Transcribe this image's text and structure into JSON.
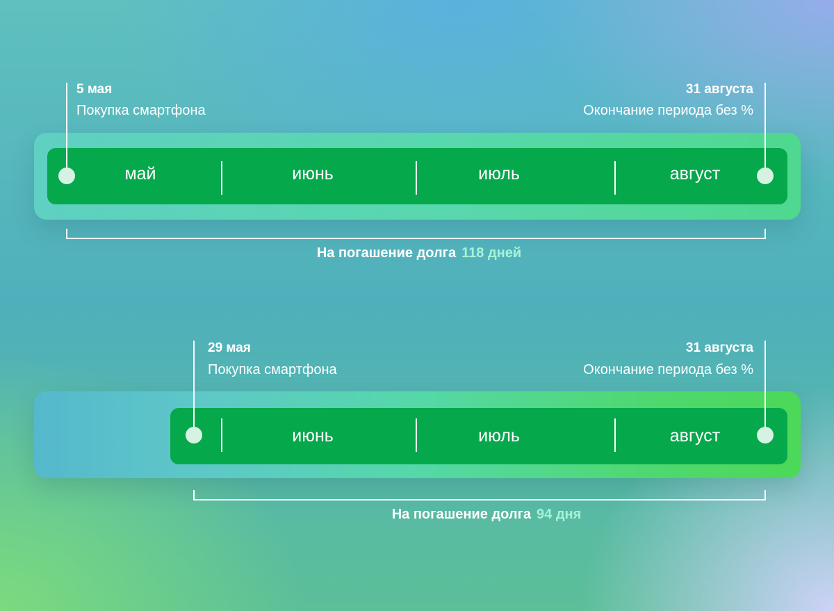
{
  "timeline1": {
    "start_date": "5 мая",
    "start_desc": "Покупка смартфона",
    "end_date": "31 августа",
    "end_desc": "Окончание периода без %",
    "months": [
      "май",
      "июнь",
      "июль",
      "август"
    ],
    "caption_prefix": "На погашение долга",
    "caption_value": "118 дней"
  },
  "timeline2": {
    "start_date": "29 мая",
    "start_desc": "Покупка смартфона",
    "end_date": "31 августа",
    "end_desc": "Окончание периода без %",
    "months": [
      "июнь",
      "июль",
      "август"
    ],
    "caption_prefix": "На погашение долга",
    "caption_value": "94 дня"
  },
  "colors": {
    "bar_fill": "#06a84c",
    "highlight_text": "#a6f3d6",
    "marker_dot": "#d6f2e2"
  }
}
